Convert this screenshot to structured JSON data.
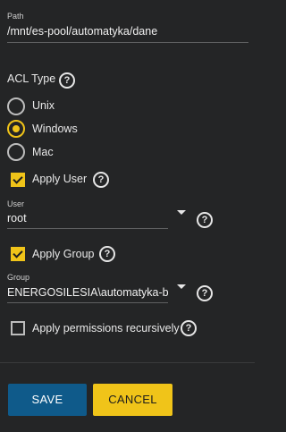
{
  "path": {
    "label": "Path",
    "value": "/mnt/es-pool/automatyka/dane"
  },
  "acl_type": {
    "label": "ACL Type",
    "options": [
      {
        "label": "Unix",
        "selected": false
      },
      {
        "label": "Windows",
        "selected": true
      },
      {
        "label": "Mac",
        "selected": false
      }
    ]
  },
  "apply_user": {
    "label": "Apply User",
    "checked": true
  },
  "user": {
    "label": "User",
    "value": "root"
  },
  "apply_group": {
    "label": "Apply Group",
    "checked": true
  },
  "group": {
    "label": "Group",
    "value": "ENERGOSILESIA\\automatyka-biuro"
  },
  "recursive": {
    "label": "Apply permissions recursively",
    "checked": false
  },
  "help_icon": "?",
  "actions": {
    "save": "SAVE",
    "cancel": "CANCEL"
  },
  "colors": {
    "background": "#242526",
    "accent": "#f0c419",
    "primary": "#0f5a8a"
  }
}
